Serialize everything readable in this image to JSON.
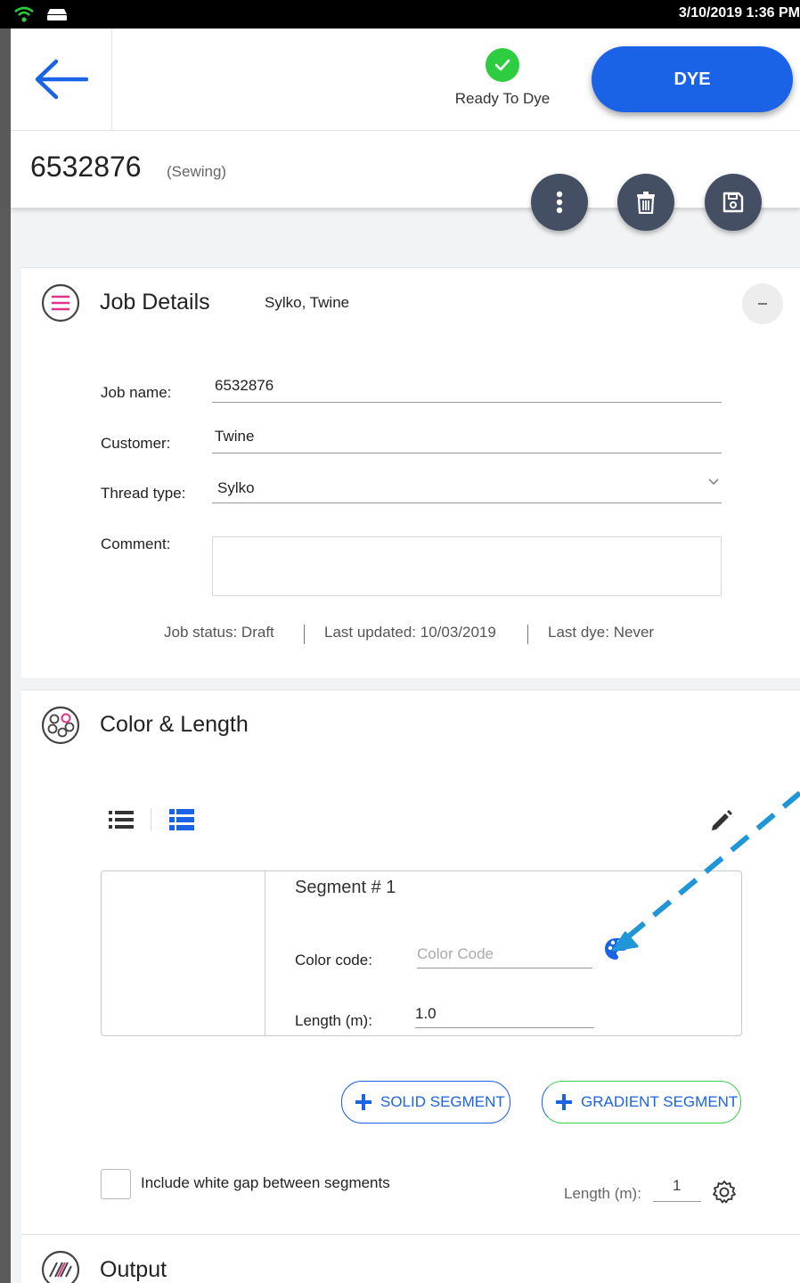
{
  "status_bar": {
    "time": "3/10/2019 1:36 PM"
  },
  "header": {
    "ready_label": "Ready To Dye",
    "dye_button": "DYE"
  },
  "job": {
    "number": "6532876",
    "type": "(Sewing)"
  },
  "job_details": {
    "title": "Job Details",
    "summary": "Sylko, Twine",
    "fields": {
      "job_name_label": "Job name:",
      "job_name_value": "6532876",
      "customer_label": "Customer:",
      "customer_value": "Twine",
      "thread_type_label": "Thread type:",
      "thread_type_value": "Sylko",
      "comment_label": "Comment:",
      "comment_value": ""
    },
    "meta": {
      "status": "Job status: Draft",
      "updated": "Last updated: 10/03/2019",
      "last_dye": "Last dye: Never"
    }
  },
  "color_length": {
    "title": "Color & Length",
    "segment": {
      "title": "Segment # 1",
      "color_code_label": "Color code:",
      "color_code_placeholder": "Color Code",
      "color_code_value": "",
      "length_label": "Length (m):",
      "length_value": "1.0"
    },
    "buttons": {
      "solid": "SOLID SEGMENT",
      "gradient": "GRADIENT SEGMENT"
    },
    "gap_checkbox_label": "Include white gap between segments",
    "gap_checkbox_checked": false,
    "gap_length_label": "Length (m):",
    "gap_length_value": "1"
  },
  "output": {
    "title": "Output"
  },
  "colors": {
    "accent": "#1b63e6",
    "success": "#2ecc40",
    "gradient_green": "#3ccf4e",
    "fab": "#454f63",
    "annotation": "#1e96d8"
  }
}
